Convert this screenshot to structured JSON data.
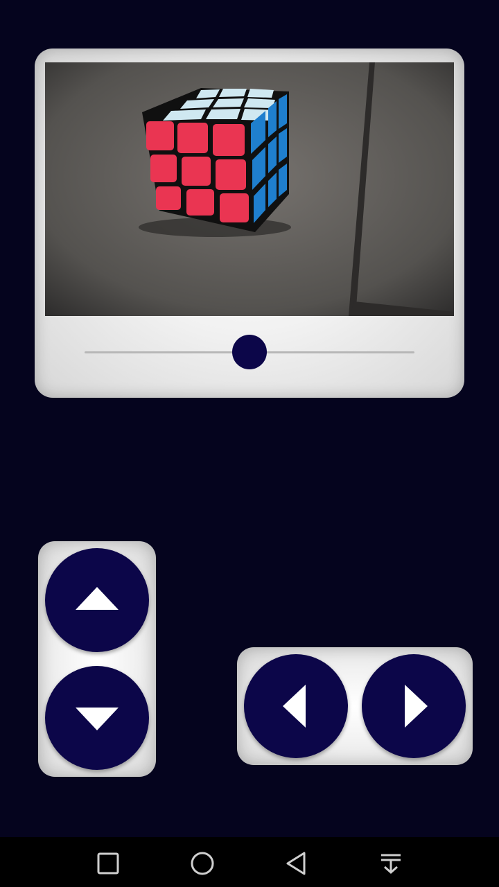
{
  "video": {
    "scene": "rubiks-cube-photo",
    "playback_position": 0.5
  },
  "controls": {
    "up_icon": "triangle-up-icon",
    "down_icon": "triangle-down-icon",
    "left_icon": "triangle-left-icon",
    "right_icon": "triangle-right-icon"
  },
  "navbar": {
    "recents_icon": "square-icon",
    "home_icon": "circle-icon",
    "back_icon": "triangle-back-icon",
    "notifications_icon": "pull-down-icon"
  },
  "colors": {
    "background": "#05041e",
    "accent": "#0c0649",
    "panel": "#f1f1f1",
    "navbar": "#000000"
  }
}
